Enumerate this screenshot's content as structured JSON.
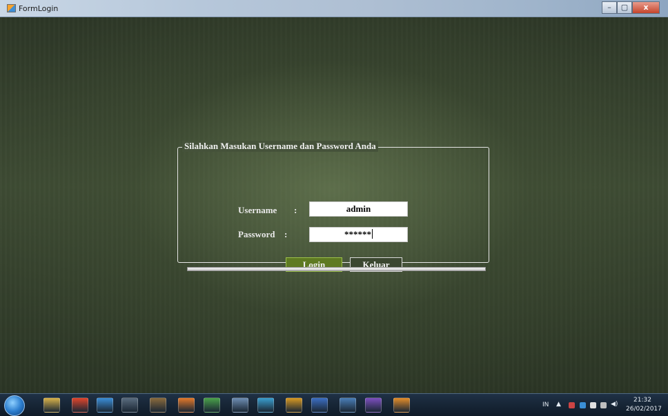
{
  "window": {
    "title": "FormLogin",
    "controls": [
      "–",
      "▢",
      "x"
    ]
  },
  "login": {
    "group_title": "Silahkan Masukan Username dan Password Anda",
    "username_label": "Username",
    "password_label": "Password",
    "colon": ":",
    "username_value": "admin",
    "password_value": "******",
    "login_button": "Login",
    "exit_button": "Keluar"
  },
  "taskbar": {
    "icons": [
      {
        "name": "file-explorer-icon",
        "color": "#d9b24a"
      },
      {
        "name": "mi-icon",
        "color": "#e1452c"
      },
      {
        "name": "media-player-icon",
        "color": "#3b8fd9"
      },
      {
        "name": "device-icon",
        "color": "#5a6c7f"
      },
      {
        "name": "calendar-icon",
        "color": "#8b6b3d"
      },
      {
        "name": "firefox-icon",
        "color": "#e5792a"
      },
      {
        "name": "network-icon",
        "color": "#4aa24a"
      },
      {
        "name": "tool-icon",
        "color": "#6f8fb4"
      },
      {
        "name": "folder-icon",
        "color": "#3a9fd0"
      },
      {
        "name": "music-icon",
        "color": "#d99a22"
      },
      {
        "name": "word-icon",
        "color": "#3c6fc4"
      },
      {
        "name": "app-icon",
        "color": "#4a7fb8"
      },
      {
        "name": "visual-studio-icon",
        "color": "#7e4fbf"
      },
      {
        "name": "winform-app-icon",
        "color": "#e58e2a"
      }
    ],
    "language": "IN",
    "time": "21:32",
    "date": "26/02/2017"
  }
}
